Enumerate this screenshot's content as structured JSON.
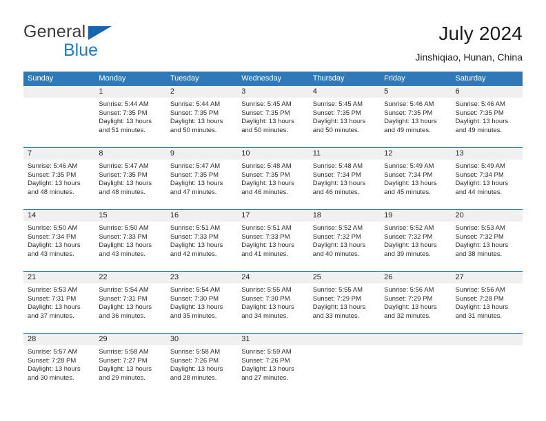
{
  "brand": {
    "name_top": "General",
    "name_bottom": "Blue",
    "flag_icon": "triangle-flag-icon",
    "color_dark": "#3b3b3b",
    "color_blue": "#1f7ac4"
  },
  "header": {
    "title": "July 2024",
    "subtitle": "Jinshiqiao, Hunan, China"
  },
  "theme": {
    "header_blue": "#3079b8",
    "day_band_gray": "#f0f0f0",
    "text": "#2b2b2b"
  },
  "calendar": {
    "weekdays": [
      "Sunday",
      "Monday",
      "Tuesday",
      "Wednesday",
      "Thursday",
      "Friday",
      "Saturday"
    ],
    "weeks": [
      [
        {
          "day": "",
          "sunrise": "",
          "sunset": "",
          "daylight_line1": "",
          "daylight_line2": ""
        },
        {
          "day": "1",
          "sunrise": "Sunrise: 5:44 AM",
          "sunset": "Sunset: 7:35 PM",
          "daylight_line1": "Daylight: 13 hours",
          "daylight_line2": "and 51 minutes."
        },
        {
          "day": "2",
          "sunrise": "Sunrise: 5:44 AM",
          "sunset": "Sunset: 7:35 PM",
          "daylight_line1": "Daylight: 13 hours",
          "daylight_line2": "and 50 minutes."
        },
        {
          "day": "3",
          "sunrise": "Sunrise: 5:45 AM",
          "sunset": "Sunset: 7:35 PM",
          "daylight_line1": "Daylight: 13 hours",
          "daylight_line2": "and 50 minutes."
        },
        {
          "day": "4",
          "sunrise": "Sunrise: 5:45 AM",
          "sunset": "Sunset: 7:35 PM",
          "daylight_line1": "Daylight: 13 hours",
          "daylight_line2": "and 50 minutes."
        },
        {
          "day": "5",
          "sunrise": "Sunrise: 5:46 AM",
          "sunset": "Sunset: 7:35 PM",
          "daylight_line1": "Daylight: 13 hours",
          "daylight_line2": "and 49 minutes."
        },
        {
          "day": "6",
          "sunrise": "Sunrise: 5:46 AM",
          "sunset": "Sunset: 7:35 PM",
          "daylight_line1": "Daylight: 13 hours",
          "daylight_line2": "and 49 minutes."
        }
      ],
      [
        {
          "day": "7",
          "sunrise": "Sunrise: 5:46 AM",
          "sunset": "Sunset: 7:35 PM",
          "daylight_line1": "Daylight: 13 hours",
          "daylight_line2": "and 48 minutes."
        },
        {
          "day": "8",
          "sunrise": "Sunrise: 5:47 AM",
          "sunset": "Sunset: 7:35 PM",
          "daylight_line1": "Daylight: 13 hours",
          "daylight_line2": "and 48 minutes."
        },
        {
          "day": "9",
          "sunrise": "Sunrise: 5:47 AM",
          "sunset": "Sunset: 7:35 PM",
          "daylight_line1": "Daylight: 13 hours",
          "daylight_line2": "and 47 minutes."
        },
        {
          "day": "10",
          "sunrise": "Sunrise: 5:48 AM",
          "sunset": "Sunset: 7:35 PM",
          "daylight_line1": "Daylight: 13 hours",
          "daylight_line2": "and 46 minutes."
        },
        {
          "day": "11",
          "sunrise": "Sunrise: 5:48 AM",
          "sunset": "Sunset: 7:34 PM",
          "daylight_line1": "Daylight: 13 hours",
          "daylight_line2": "and 46 minutes."
        },
        {
          "day": "12",
          "sunrise": "Sunrise: 5:49 AM",
          "sunset": "Sunset: 7:34 PM",
          "daylight_line1": "Daylight: 13 hours",
          "daylight_line2": "and 45 minutes."
        },
        {
          "day": "13",
          "sunrise": "Sunrise: 5:49 AM",
          "sunset": "Sunset: 7:34 PM",
          "daylight_line1": "Daylight: 13 hours",
          "daylight_line2": "and 44 minutes."
        }
      ],
      [
        {
          "day": "14",
          "sunrise": "Sunrise: 5:50 AM",
          "sunset": "Sunset: 7:34 PM",
          "daylight_line1": "Daylight: 13 hours",
          "daylight_line2": "and 43 minutes."
        },
        {
          "day": "15",
          "sunrise": "Sunrise: 5:50 AM",
          "sunset": "Sunset: 7:33 PM",
          "daylight_line1": "Daylight: 13 hours",
          "daylight_line2": "and 43 minutes."
        },
        {
          "day": "16",
          "sunrise": "Sunrise: 5:51 AM",
          "sunset": "Sunset: 7:33 PM",
          "daylight_line1": "Daylight: 13 hours",
          "daylight_line2": "and 42 minutes."
        },
        {
          "day": "17",
          "sunrise": "Sunrise: 5:51 AM",
          "sunset": "Sunset: 7:33 PM",
          "daylight_line1": "Daylight: 13 hours",
          "daylight_line2": "and 41 minutes."
        },
        {
          "day": "18",
          "sunrise": "Sunrise: 5:52 AM",
          "sunset": "Sunset: 7:32 PM",
          "daylight_line1": "Daylight: 13 hours",
          "daylight_line2": "and 40 minutes."
        },
        {
          "day": "19",
          "sunrise": "Sunrise: 5:52 AM",
          "sunset": "Sunset: 7:32 PM",
          "daylight_line1": "Daylight: 13 hours",
          "daylight_line2": "and 39 minutes."
        },
        {
          "day": "20",
          "sunrise": "Sunrise: 5:53 AM",
          "sunset": "Sunset: 7:32 PM",
          "daylight_line1": "Daylight: 13 hours",
          "daylight_line2": "and 38 minutes."
        }
      ],
      [
        {
          "day": "21",
          "sunrise": "Sunrise: 5:53 AM",
          "sunset": "Sunset: 7:31 PM",
          "daylight_line1": "Daylight: 13 hours",
          "daylight_line2": "and 37 minutes."
        },
        {
          "day": "22",
          "sunrise": "Sunrise: 5:54 AM",
          "sunset": "Sunset: 7:31 PM",
          "daylight_line1": "Daylight: 13 hours",
          "daylight_line2": "and 36 minutes."
        },
        {
          "day": "23",
          "sunrise": "Sunrise: 5:54 AM",
          "sunset": "Sunset: 7:30 PM",
          "daylight_line1": "Daylight: 13 hours",
          "daylight_line2": "and 35 minutes."
        },
        {
          "day": "24",
          "sunrise": "Sunrise: 5:55 AM",
          "sunset": "Sunset: 7:30 PM",
          "daylight_line1": "Daylight: 13 hours",
          "daylight_line2": "and 34 minutes."
        },
        {
          "day": "25",
          "sunrise": "Sunrise: 5:55 AM",
          "sunset": "Sunset: 7:29 PM",
          "daylight_line1": "Daylight: 13 hours",
          "daylight_line2": "and 33 minutes."
        },
        {
          "day": "26",
          "sunrise": "Sunrise: 5:56 AM",
          "sunset": "Sunset: 7:29 PM",
          "daylight_line1": "Daylight: 13 hours",
          "daylight_line2": "and 32 minutes."
        },
        {
          "day": "27",
          "sunrise": "Sunrise: 5:56 AM",
          "sunset": "Sunset: 7:28 PM",
          "daylight_line1": "Daylight: 13 hours",
          "daylight_line2": "and 31 minutes."
        }
      ],
      [
        {
          "day": "28",
          "sunrise": "Sunrise: 5:57 AM",
          "sunset": "Sunset: 7:28 PM",
          "daylight_line1": "Daylight: 13 hours",
          "daylight_line2": "and 30 minutes."
        },
        {
          "day": "29",
          "sunrise": "Sunrise: 5:58 AM",
          "sunset": "Sunset: 7:27 PM",
          "daylight_line1": "Daylight: 13 hours",
          "daylight_line2": "and 29 minutes."
        },
        {
          "day": "30",
          "sunrise": "Sunrise: 5:58 AM",
          "sunset": "Sunset: 7:26 PM",
          "daylight_line1": "Daylight: 13 hours",
          "daylight_line2": "and 28 minutes."
        },
        {
          "day": "31",
          "sunrise": "Sunrise: 5:59 AM",
          "sunset": "Sunset: 7:26 PM",
          "daylight_line1": "Daylight: 13 hours",
          "daylight_line2": "and 27 minutes."
        },
        {
          "day": "",
          "sunrise": "",
          "sunset": "",
          "daylight_line1": "",
          "daylight_line2": ""
        },
        {
          "day": "",
          "sunrise": "",
          "sunset": "",
          "daylight_line1": "",
          "daylight_line2": ""
        },
        {
          "day": "",
          "sunrise": "",
          "sunset": "",
          "daylight_line1": "",
          "daylight_line2": ""
        }
      ]
    ]
  }
}
